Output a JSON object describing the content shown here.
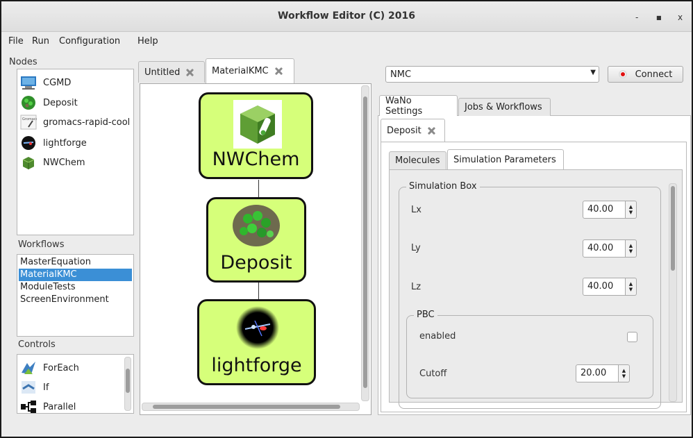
{
  "window": {
    "title": "Workflow Editor (C) 2016",
    "minimize": "-",
    "maximize": "■",
    "close": "x"
  },
  "menu": [
    "File",
    "Run",
    "Configuration",
    "Help"
  ],
  "nodes": {
    "label": "Nodes",
    "items": [
      "CGMD",
      "Deposit",
      "gromacs-rapid-cool",
      "lightforge",
      "NWChem"
    ]
  },
  "workflows": {
    "label": "Workflows",
    "items": [
      "MasterEquation",
      "MaterialKMC",
      "ModuleTests",
      "ScreenEnvironment"
    ],
    "selected": "MaterialKMC"
  },
  "controls": {
    "label": "Controls",
    "items": [
      "ForEach",
      "If",
      "Parallel"
    ]
  },
  "editor_tabs": [
    "Untitled",
    "MaterialKMC"
  ],
  "canvas_nodes": [
    "NWChem",
    "Deposit",
    "lightforge"
  ],
  "right": {
    "combo": "NMC",
    "connect": "Connect",
    "top_tabs": [
      "WaNo Settings",
      "Jobs & Workflows"
    ],
    "subtab": "Deposit",
    "inner_tabs": [
      "Molecules",
      "Simulation Parameters"
    ],
    "sim_box": {
      "title": "Simulation Box",
      "fields": [
        {
          "label": "Lx",
          "value": "40.00"
        },
        {
          "label": "Ly",
          "value": "40.00"
        },
        {
          "label": "Lz",
          "value": "40.00"
        }
      ]
    },
    "pbc": {
      "title": "PBC",
      "enabled": "enabled",
      "cutoff_label": "Cutoff",
      "cutoff_value": "20.00"
    }
  }
}
